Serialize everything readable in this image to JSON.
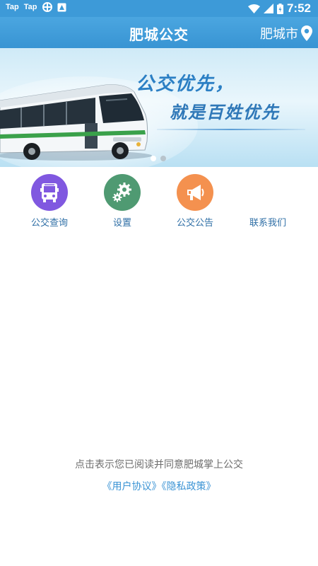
{
  "status_bar": {
    "left_icons": [
      "Tap",
      "Tap"
    ],
    "time": "7:52"
  },
  "header": {
    "title": "肥城公交",
    "city": "肥城市"
  },
  "banner": {
    "slogan_line1": "公交优先，",
    "slogan_line2": "就是百姓优先",
    "slide_count": 2,
    "active_slide": 1
  },
  "menu": {
    "items": [
      {
        "label": "公交查询",
        "icon": "bus-icon",
        "color": "#8058e0"
      },
      {
        "label": "设置",
        "icon": "gears-icon",
        "color": "#4f9a72"
      },
      {
        "label": "公交公告",
        "icon": "megaphone-icon",
        "color": "#f4914f"
      },
      {
        "label": "联系我们",
        "icon": "",
        "color": ""
      }
    ]
  },
  "agreement": {
    "text": "点击表示您已阅读并同意肥城掌上公交",
    "user_agreement": "《用户协议》",
    "privacy_policy": "《隐私政策》"
  },
  "colors": {
    "primary": "#3d9ad8",
    "link": "#3a93d4",
    "label": "#2f6fa6"
  }
}
